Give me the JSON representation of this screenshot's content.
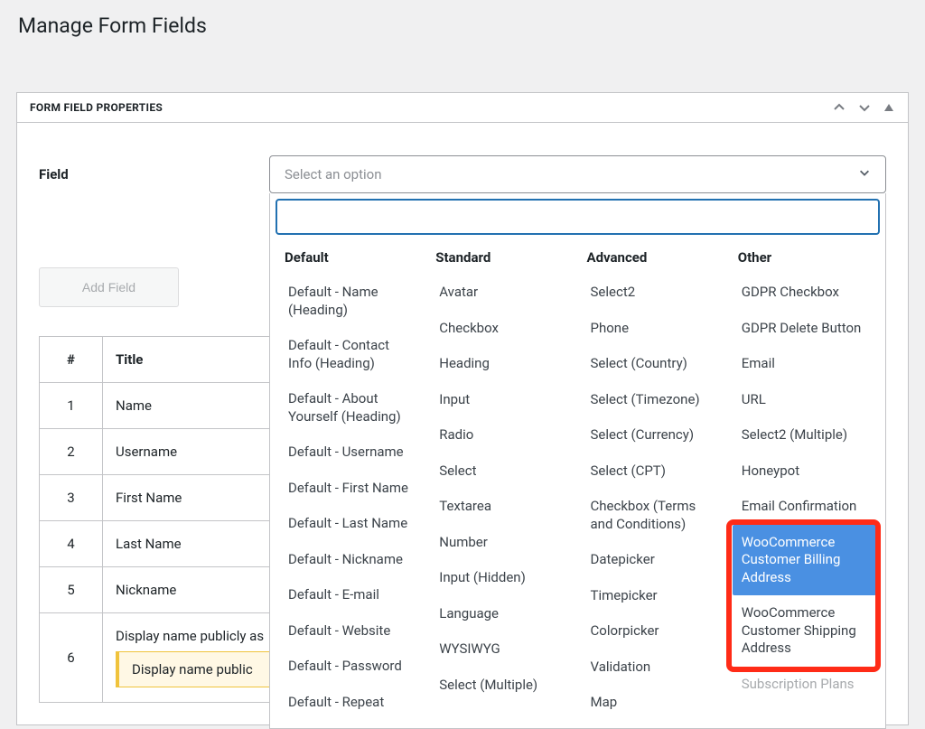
{
  "page": {
    "title": "Manage Form Fields"
  },
  "panel": {
    "header": "FORM FIELD PROPERTIES"
  },
  "field": {
    "label": "Field",
    "placeholder": "Select an option",
    "add_button": "Add Field"
  },
  "dropdown": {
    "groups": {
      "default": {
        "label": "Default",
        "items": [
          "Default - Name (Heading)",
          "Default - Contact Info (Heading)",
          "Default - About Yourself (Heading)",
          "Default - Username",
          "Default - First Name",
          "Default - Last Name",
          "Default - Nickname",
          "Default - E-mail",
          "Default - Website",
          "Default - Password",
          "Default - Repeat"
        ]
      },
      "standard": {
        "label": "Standard",
        "items": [
          "Avatar",
          "Checkbox",
          "Heading",
          "Input",
          "Radio",
          "Select",
          "Textarea",
          "Number",
          "Input (Hidden)",
          "Language",
          "WYSIWYG",
          "Select (Multiple)"
        ]
      },
      "advanced": {
        "label": "Advanced",
        "items": [
          "Select2",
          "Phone",
          "Select (Country)",
          "Select (Timezone)",
          "Select (Currency)",
          "Select (CPT)",
          "Checkbox (Terms and Conditions)",
          "Datepicker",
          "Timepicker",
          "Colorpicker",
          "Validation",
          "Map"
        ]
      },
      "other": {
        "label": "Other",
        "items": [
          "GDPR Checkbox",
          "GDPR Delete Button",
          "Email",
          "URL",
          "Select2 (Multiple)",
          "Honeypot",
          "Email Confirmation",
          "WooCommerce Customer Billing Address",
          "WooCommerce Customer Shipping Address",
          "Subscription Plans"
        ],
        "highlighted_index": 7,
        "disabled_index": 9
      }
    }
  },
  "table": {
    "headers": {
      "num": "#",
      "title": "Title"
    },
    "rows": [
      {
        "num": "1",
        "title": "Name"
      },
      {
        "num": "2",
        "title": "Username"
      },
      {
        "num": "3",
        "title": "First Name"
      },
      {
        "num": "4",
        "title": "Last Name"
      },
      {
        "num": "5",
        "title": "Nickname"
      },
      {
        "num": "6",
        "title": "Display name publicly as",
        "warn": "Display name public"
      }
    ]
  }
}
